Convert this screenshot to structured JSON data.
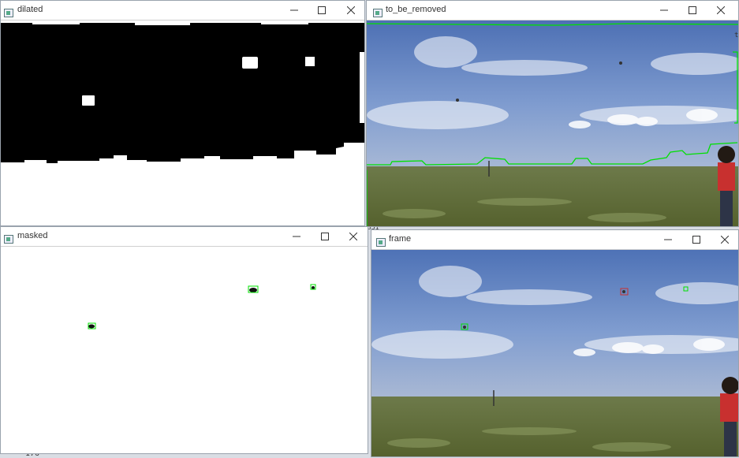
{
  "windows": {
    "dilated": {
      "title": "dilated"
    },
    "to_be_removed": {
      "title": "to_be_removed"
    },
    "masked": {
      "title": "masked"
    },
    "frame": {
      "title": "frame"
    }
  },
  "background": {
    "fragment_bottom": "176",
    "fragment_mid": "351",
    "fragment_side": "t"
  },
  "icons": {
    "minimize": "minimize-icon",
    "maximize": "maximize-icon",
    "close": "close-icon",
    "app": "opencv-window-icon"
  },
  "colors": {
    "contour": "#00e000",
    "titlebar": "#ffffff",
    "sky_top": "#4f73b6",
    "grass": "#5f6e33"
  }
}
